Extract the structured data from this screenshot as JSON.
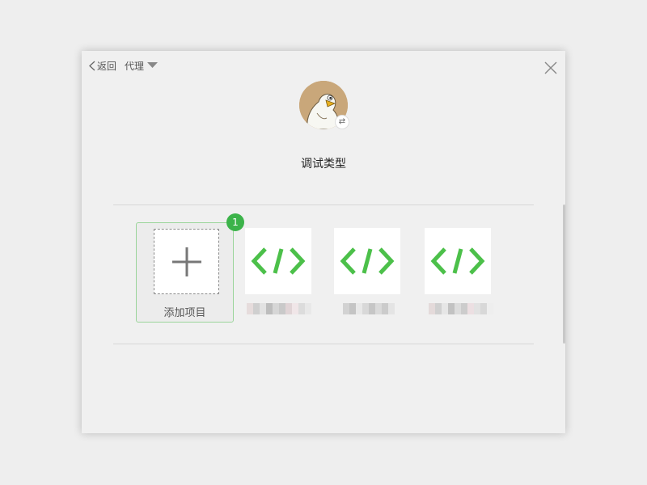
{
  "header": {
    "back_label": "返回",
    "proxy_label": "代理"
  },
  "profile": {
    "switch_symbol": "⇄",
    "debug_type": "调试类型"
  },
  "add_project": {
    "label": "添加项目",
    "badge_count": "1"
  },
  "projects": [
    {
      "icon": "code-icon",
      "name_blurred": true
    },
    {
      "icon": "code-icon",
      "name_blurred": true
    },
    {
      "icon": "code-icon",
      "name_blurred": true
    }
  ],
  "colors": {
    "accent_green": "#3cb34a",
    "code_icon_green": "#4cc04a",
    "card_border": "#9bd59b"
  }
}
